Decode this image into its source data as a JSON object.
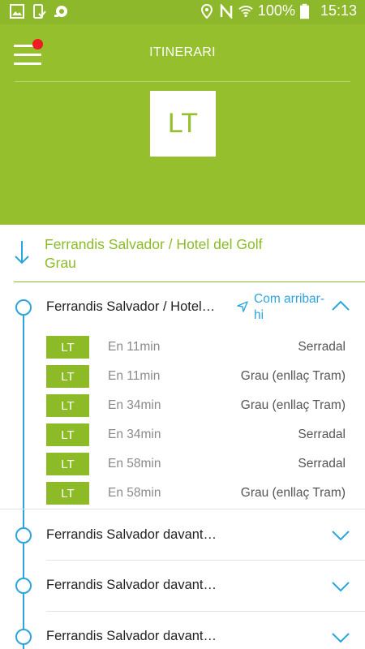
{
  "status_bar": {
    "battery": "100%",
    "time": "15:13",
    "left_icons": [
      "image-icon",
      "phone-check-icon",
      "voicemail-icon"
    ],
    "right_icons": [
      "location-icon",
      "nfc-icon",
      "wifi-icon",
      "battery-icon"
    ]
  },
  "header": {
    "title": "ITINERARI",
    "line_code": "LT",
    "menu_icon": "hamburger-menu-icon",
    "notification_dot_color": "#ee1c25"
  },
  "route": {
    "direction_icon": "arrow-down-icon",
    "line1": "Ferrandis Salvador / Hotel del Golf",
    "line2": "Grau"
  },
  "colors": {
    "brand_green": "#96bf2e",
    "accent_blue": "#2aa5e0"
  },
  "stops": [
    {
      "name": "Ferrandis Salvador / Hotel…",
      "expanded": true,
      "how_to_get": "Com arribar-hi",
      "departures": [
        {
          "line": "LT",
          "time": "En 11min",
          "destination": "Serradal"
        },
        {
          "line": "LT",
          "time": "En 11min",
          "destination": "Grau (enllaç Tram)"
        },
        {
          "line": "LT",
          "time": "En 34min",
          "destination": "Grau (enllaç Tram)"
        },
        {
          "line": "LT",
          "time": "En 34min",
          "destination": "Serradal"
        },
        {
          "line": "LT",
          "time": "En 58min",
          "destination": "Serradal"
        },
        {
          "line": "LT",
          "time": "En 58min",
          "destination": "Grau (enllaç Tram)"
        }
      ]
    },
    {
      "name": "Ferrandis Salvador davant…",
      "expanded": false
    },
    {
      "name": "Ferrandis Salvador davant…",
      "expanded": false
    },
    {
      "name": "Ferrandis Salvador davant…",
      "expanded": false
    }
  ]
}
